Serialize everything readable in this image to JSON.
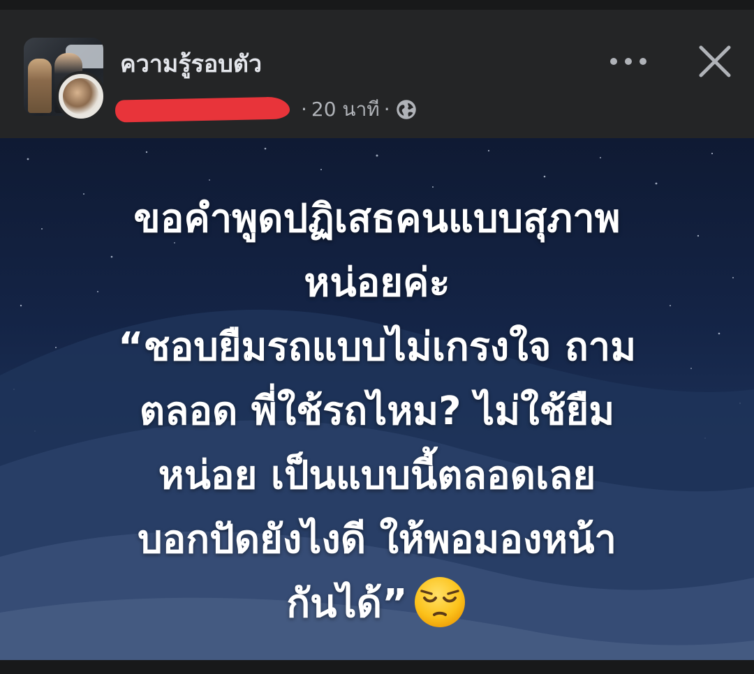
{
  "header": {
    "page_name": "ความรู้รอบตัว",
    "separator": "·",
    "post_time": "20 นาที",
    "globe_icon": "globe-icon",
    "more_icon": "more-horizontal-icon",
    "close_icon": "close-icon"
  },
  "post": {
    "lines": [
      "ขอคำพูดปฏิเสธคนแบบสุภาพ",
      "หน่อยค่ะ",
      "“ชอบยืมรถแบบไม่เกรงใจ ถาม",
      "ตลอด พี่ใช้รถไหม? ไม่ใช้ยืม",
      "หน่อย เป็นแบบนี้ตลอดเลย",
      "บอกปัดยังไงดี ให้พอมองหน้า",
      "กันได้”"
    ],
    "emoji": "pensive-face-emoji"
  },
  "colors": {
    "background": "#242526",
    "name_text": "#e4e6eb",
    "meta_text": "#b0b3b8",
    "redaction": "#e8343a",
    "post_text": "#ffffff"
  }
}
